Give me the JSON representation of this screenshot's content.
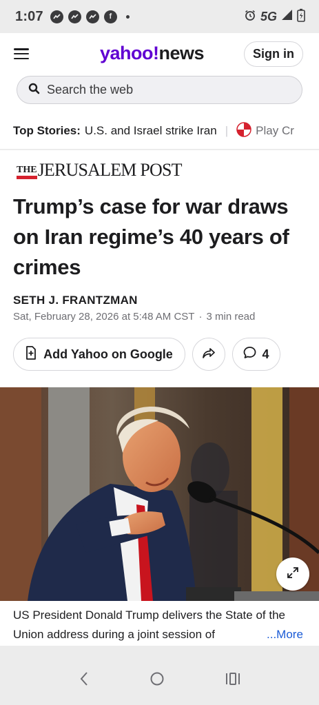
{
  "status_bar": {
    "time": "1:07",
    "network": "5G",
    "notification_icons": [
      "messenger-icon",
      "messenger-icon",
      "messenger-icon",
      "facebook-icon"
    ]
  },
  "header": {
    "logo_yahoo": "yahoo!",
    "logo_news": "news",
    "sign_in_label": "Sign in",
    "search_placeholder": "Search the web"
  },
  "top_stories": {
    "label": "Top Stories:",
    "headline": "U.S. and Israel strike Iran",
    "play_label": "Play Cr"
  },
  "article": {
    "publisher_the": "THE",
    "publisher_name": "JERUSALEM POST",
    "title": "Trump’s case for war draws on Iran regime’s 40 years of crimes",
    "author": "SETH J. FRANTZMAN",
    "date": "Sat, February 28, 2026 at 5:48 AM CST",
    "read_time": "3 min read",
    "add_google_label": "Add Yahoo on Google",
    "comment_count": "4",
    "caption": "US President Donald Trump delivers the State of the Union address during a joint session of",
    "more_label": "...More"
  },
  "colors": {
    "yahoo_purple": "#6001d2",
    "jpost_red": "#d5212e",
    "link_blue": "#1a5bd6"
  }
}
